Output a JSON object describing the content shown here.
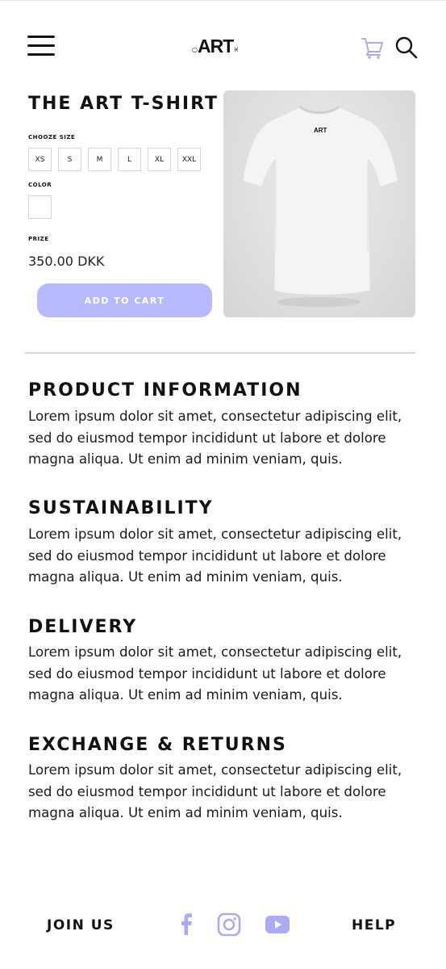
{
  "header": {
    "logo_text": "ART",
    "logo_mark_left": "○",
    "logo_mark_right": "♓"
  },
  "product": {
    "title": "THE ART T-SHIRT",
    "size_label": "CHOOZE SIZE",
    "sizes": [
      "XS",
      "S",
      "M",
      "L",
      "XL",
      "XXL"
    ],
    "color_label": "COLOR",
    "price_label": "PRIZE",
    "price": "350.00 DKK",
    "add_to_cart": "ADD TO CART",
    "shirt_print": "ART"
  },
  "sections": [
    {
      "heading": "PRODUCT INFORMATION",
      "body": "Lorem ipsum dolor sit amet, consectetur adipiscing elit, sed do eiusmod tempor incididunt ut labore et dolore magna aliqua. Ut enim ad minim veniam, quis."
    },
    {
      "heading": "SUSTAINABILITY",
      "body": "Lorem ipsum dolor sit amet, consectetur adipiscing elit, sed do eiusmod tempor incididunt ut labore et dolore magna aliqua. Ut enim ad minim veniam, quis."
    },
    {
      "heading": "DELIVERY",
      "body": "Lorem ipsum dolor sit amet, consectetur adipiscing elit, sed do eiusmod tempor incididunt ut labore et dolore magna aliqua. Ut enim ad minim veniam, quis."
    },
    {
      "heading": "EXCHANGE & RETURNS",
      "body": "Lorem ipsum dolor sit amet, consectetur adipiscing elit, sed do eiusmod tempor incididunt ut labore et dolore magna aliqua. Ut enim ad minim veniam, quis."
    }
  ],
  "footer": {
    "join": "JOIN US",
    "help": "HELP",
    "social_icons": [
      "facebook-icon",
      "instagram-icon",
      "youtube-icon"
    ]
  },
  "colors": {
    "accent": "#b7b9ff",
    "icon_accent": "#a9abf5",
    "text": "#111111"
  }
}
